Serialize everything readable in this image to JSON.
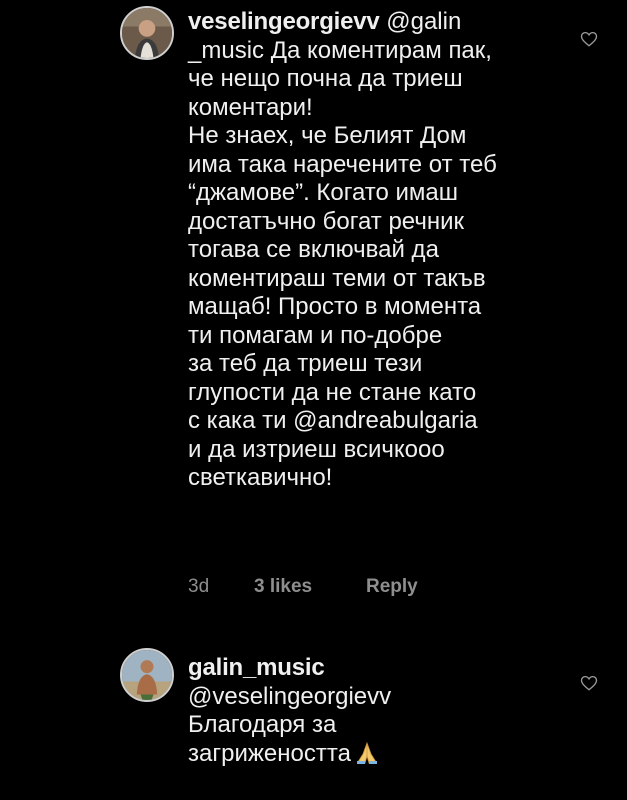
{
  "comments": [
    {
      "username": "veselingeorgievv",
      "lines": [
        " @galin",
        "_music Да коментирам пак,",
        "че нещо почна да триеш",
        "коментари!",
        "Не знаех, че Белият Дом",
        "има така наречените от теб",
        "“джамове”. Когато имаш",
        "достатъчно богат речник",
        "тогава се включвай да",
        "коментираш теми от такъв",
        "мащаб! Просто в момента",
        "ти помагам и по-добре",
        "за теб да триеш тези",
        "глупости да не стане като",
        "с кака ти @andreabulgaria",
        "и да изтриеш всичкооо",
        "светкавично!"
      ],
      "time": "3d",
      "likes": "3 likes",
      "reply": "Reply"
    },
    {
      "username": "galin_music",
      "lines": [
        "@veselingeorgievv",
        "Благодаря за",
        "загрижеността"
      ]
    }
  ],
  "icons": {
    "like": "heart-outline-icon",
    "emoji": "folded-hands-emoji"
  },
  "colors": {
    "background": "#000000",
    "text": "#f0f0f0",
    "muted": "#8e8e8e"
  }
}
